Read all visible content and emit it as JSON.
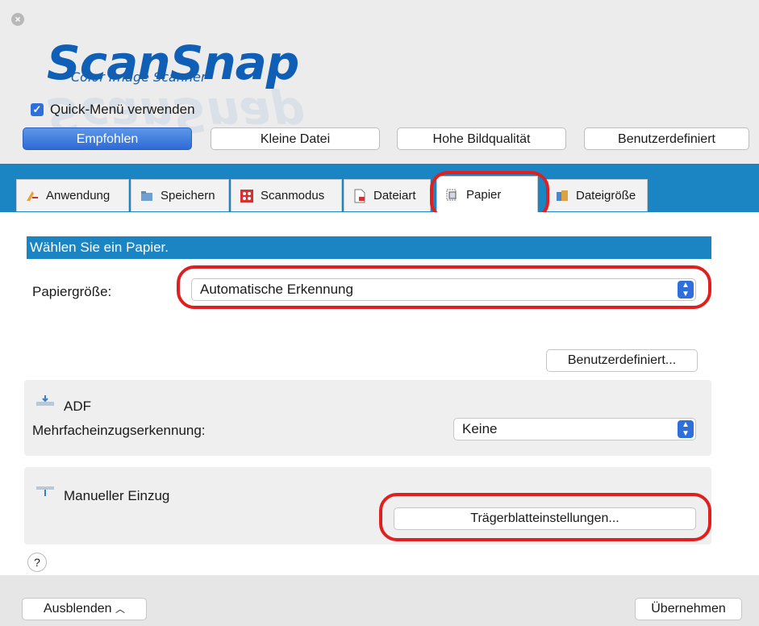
{
  "window": {
    "close_icon": "close-icon"
  },
  "logo": {
    "main": "ScanSnap",
    "sub": "Color Image Scanner"
  },
  "quick_menu": {
    "label": "Quick-Menü verwenden",
    "checked": true
  },
  "modes": [
    {
      "label": "Empfohlen",
      "active": true
    },
    {
      "label": "Kleine Datei",
      "active": false
    },
    {
      "label": "Hohe Bildqualität",
      "active": false
    },
    {
      "label": "Benutzerdefiniert",
      "active": false
    }
  ],
  "tabs": [
    {
      "label": "Anwendung",
      "icon": "application-icon"
    },
    {
      "label": "Speichern",
      "icon": "save-folder-icon"
    },
    {
      "label": "Scanmodus",
      "icon": "scan-mode-icon"
    },
    {
      "label": "Dateiart",
      "icon": "file-type-icon"
    },
    {
      "label": "Papier",
      "icon": "paper-icon",
      "active": true
    },
    {
      "label": "Dateigröße",
      "icon": "file-size-icon"
    }
  ],
  "paper": {
    "header": "Wählen Sie ein Papier.",
    "size_label": "Papiergröße:",
    "size_value": "Automatische Erkennung",
    "custom_button": "Benutzerdefiniert...",
    "adf": {
      "title": "ADF",
      "multifeed_label": "Mehrfacheinzugserkennung:",
      "multifeed_value": "Keine"
    },
    "manual": {
      "title": "Manueller Einzug",
      "carrier_button": "Trägerblatteinstellungen..."
    }
  },
  "help": {
    "label": "?"
  },
  "bottom": {
    "hide_button": "Ausblenden",
    "apply_button": "Übernehmen"
  },
  "colors": {
    "accent_blue": "#1b84c2",
    "highlight_red": "#e02020",
    "active_button": "#2e6ad6"
  }
}
